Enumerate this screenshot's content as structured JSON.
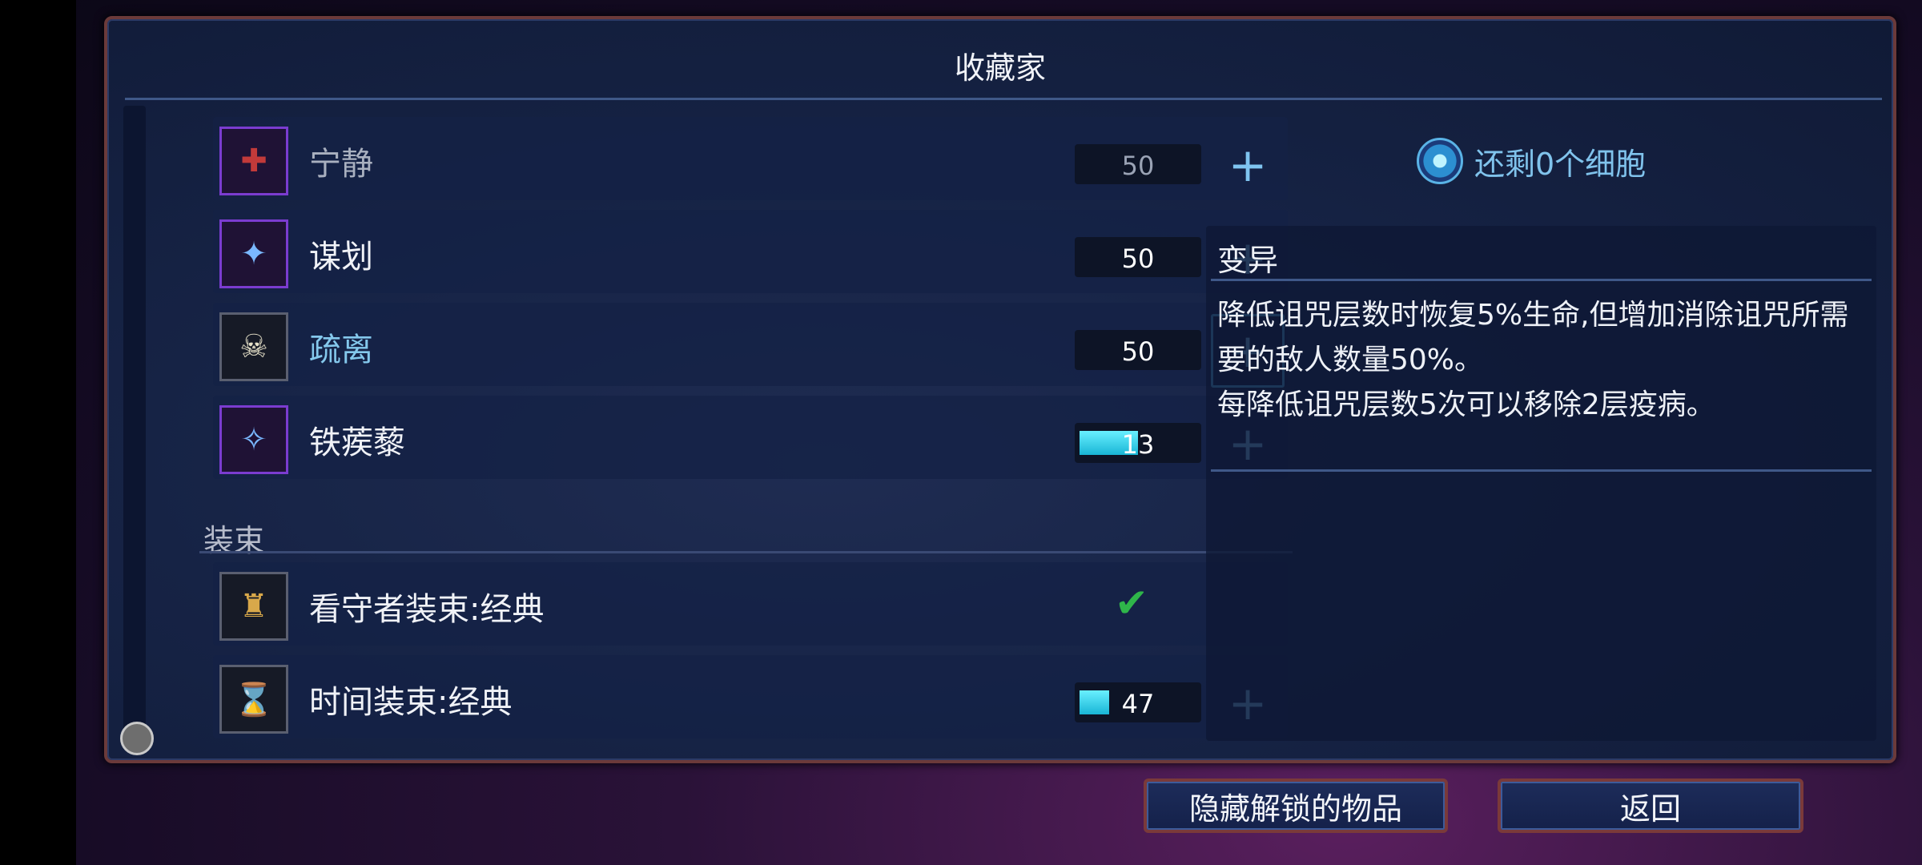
{
  "window": {
    "title": "收藏家"
  },
  "mutations": [
    {
      "icon": "tranquility-icon",
      "icon_glyph": "✚",
      "label": "宁静",
      "value": "50",
      "state": "dim"
    },
    {
      "icon": "scheme-icon",
      "icon_glyph": "✦",
      "label": "谋划",
      "value": "50",
      "state": "normal"
    },
    {
      "icon": "skull-icon",
      "icon_glyph": "☠",
      "label": "疏离",
      "value": "50",
      "state": "selected"
    },
    {
      "icon": "caltrops-icon",
      "icon_glyph": "✧",
      "label": "铁蒺藜",
      "value": "13",
      "progress": 0.5,
      "state": "normal"
    }
  ],
  "outfits_section": {
    "label": "装束"
  },
  "outfits": [
    {
      "icon": "keeper-outfit-icon",
      "icon_glyph": "♜",
      "label": "看守者装束:经典",
      "status": "✔",
      "unlocked": true
    },
    {
      "icon": "time-outfit-icon",
      "icon_glyph": "⌛",
      "label": "时间装束:经典",
      "value": "47",
      "progress": 0.25
    }
  ],
  "plus_glyph": "+",
  "cells": {
    "text": "还剩0个细胞"
  },
  "detail": {
    "title": "变异",
    "body_line1": "降低诅咒层数时恢复5%生命,但增加消除诅咒所需要的敌人数量50%。",
    "body_line2": "每降低诅咒层数5次可以移除2层疫病。"
  },
  "buttons": {
    "hide_unlocked": "隐藏解锁的物品",
    "back": "返回"
  },
  "colors": {
    "accent": "#4fb0df",
    "progress_fill": "#19b5d6",
    "check": "#2fb54a",
    "frame_border": "#6b3a3a"
  }
}
